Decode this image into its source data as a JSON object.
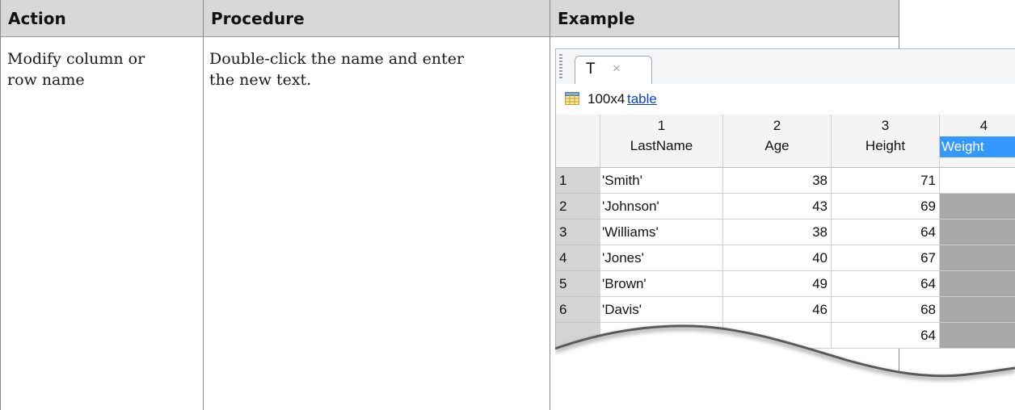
{
  "headers": {
    "action": "Action",
    "procedure": "Procedure",
    "example": "Example"
  },
  "row": {
    "action_line1": "Modify column or",
    "action_line2": "row name",
    "procedure_line1": "Double-click the name and enter",
    "procedure_line2": "the new text."
  },
  "editor": {
    "tab_label": "T",
    "tab_close": "×",
    "dims": "100x4",
    "type_link": "table",
    "columns": [
      {
        "num": "1",
        "name": "LastName"
      },
      {
        "num": "2",
        "name": "Age"
      },
      {
        "num": "3",
        "name": "Height"
      },
      {
        "num": "4",
        "name": "Weight"
      }
    ],
    "rows": [
      {
        "idx": "1",
        "last": "'Smith'",
        "age": "38",
        "height": "71"
      },
      {
        "idx": "2",
        "last": "'Johnson'",
        "age": "43",
        "height": "69"
      },
      {
        "idx": "3",
        "last": "'Williams'",
        "age": "38",
        "height": "64"
      },
      {
        "idx": "4",
        "last": "'Jones'",
        "age": "40",
        "height": "67"
      },
      {
        "idx": "5",
        "last": "'Brown'",
        "age": "49",
        "height": "64"
      },
      {
        "idx": "6",
        "last": "'Davis'",
        "age": "46",
        "height": "68"
      },
      {
        "idx": "",
        "last": "",
        "age": "",
        "height": "64"
      }
    ],
    "selection_color": "#3399ff",
    "icon": "table-grid-icon"
  }
}
